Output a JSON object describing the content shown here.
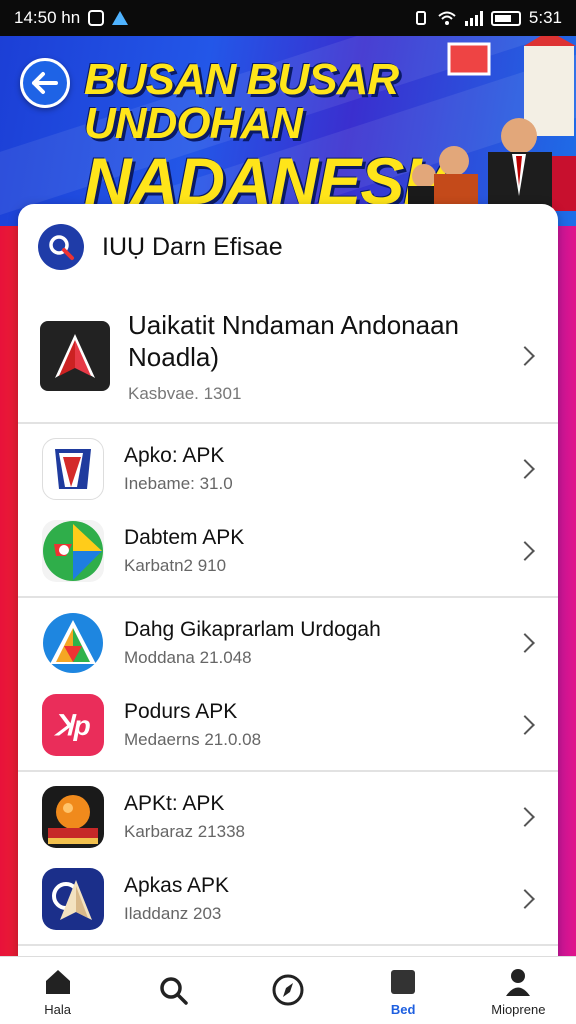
{
  "status_bar": {
    "time": "14:50 hn",
    "right_time": "5:31"
  },
  "banner": {
    "line1": "BUSAN BUSAR UNDOHAN",
    "line2": "NADANESIA"
  },
  "card": {
    "title": "IUỤ Darn Efisae",
    "featured": {
      "name": "Uaikatit Nndaman Andonaan Noadla)",
      "subtitle": "Kasbvae. 1301"
    },
    "groups": [
      [
        {
          "name": "Apko: APK",
          "subtitle": "Inebame: 31.0",
          "icon": "red-blue-flag-icon"
        },
        {
          "name": "Dabtem APK",
          "subtitle": "Karbatn2 910",
          "icon": "green-drive-icon"
        }
      ],
      [
        {
          "name": "Dahg Gikaprarlam Urdogah",
          "subtitle": "Moddana 21.048",
          "icon": "blue-triangle-icon"
        },
        {
          "name": "Podurs APK",
          "subtitle": "Medaerns 21.0.08",
          "icon": "red-cup-icon"
        }
      ],
      [
        {
          "name": "APKt: APK",
          "subtitle": "Karbaraz 21338",
          "icon": "orange-ball-icon"
        },
        {
          "name": "Apkas APK",
          "subtitle": "Iladdanz 203",
          "icon": "navy-arrow-icon"
        }
      ]
    ]
  },
  "bottom_nav": [
    {
      "label": "Hala",
      "icon": "home-icon"
    },
    {
      "label": "",
      "icon": "search-icon"
    },
    {
      "label": "",
      "icon": "compass-icon"
    },
    {
      "label": "Bed",
      "icon": "tablet-icon",
      "active": true
    },
    {
      "label": "Mioprene",
      "icon": "person-icon"
    }
  ],
  "colors": {
    "accent": "#1e5fe0",
    "banner_text": "#ffe51a"
  }
}
